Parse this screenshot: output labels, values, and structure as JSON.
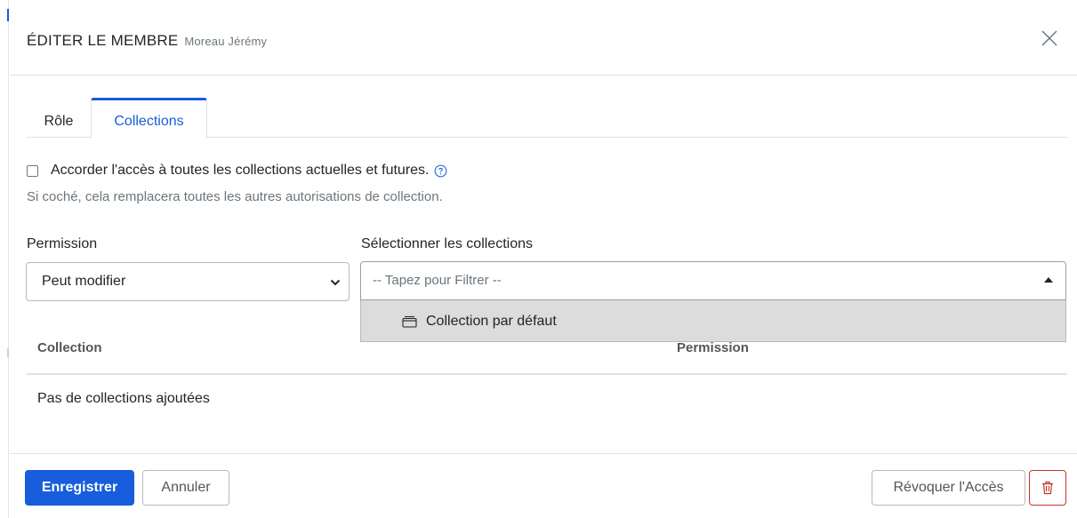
{
  "header": {
    "title": "ÉDITER LE MEMBRE",
    "subtitle": "Moreau Jérémy"
  },
  "tabs": [
    {
      "label": "Rôle",
      "active": false
    },
    {
      "label": "Collections",
      "active": true
    }
  ],
  "access": {
    "checkbox_label": "Accorder l'accès à toutes les collections actuelles et futures.",
    "checked": false,
    "hint": "Si coché, cela remplacera toutes les autres autorisations de collection."
  },
  "permission": {
    "label": "Permission",
    "selected": "Peut modifier"
  },
  "collections_select": {
    "label": "Sélectionner les collections",
    "placeholder": "-- Tapez pour Filtrer --",
    "options": [
      "Collection par défaut"
    ]
  },
  "table": {
    "col_collection": "Collection",
    "col_permission": "Permission",
    "empty": "Pas de collections ajoutées"
  },
  "footer": {
    "save": "Enregistrer",
    "cancel": "Annuler",
    "revoke": "Révoquer l'Accès"
  },
  "icons": {
    "close": "close-icon",
    "help": "question-circle-icon",
    "chevron": "chevron-down-icon",
    "collection": "collection-icon",
    "trash": "trash-icon"
  },
  "colors": {
    "primary": "#175ddc",
    "danger": "#c83522",
    "muted": "#6c757d"
  }
}
